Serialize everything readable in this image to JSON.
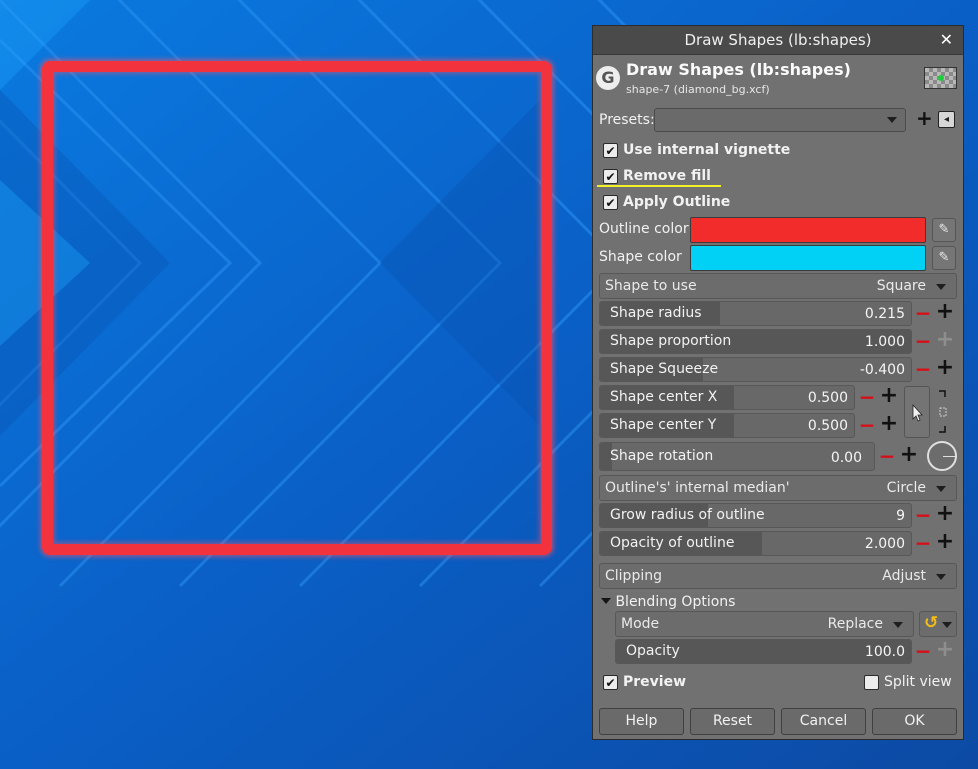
{
  "dialog": {
    "window_title": "Draw Shapes (lb:shapes)",
    "plugin_name": "Draw Shapes (lb:shapes)",
    "file_name": "shape-7 (diamond_bg.xcf)",
    "presets_label": "Presets:",
    "checks": {
      "vignette": "Use internal vignette",
      "remove_fill": "Remove fill",
      "apply_outline": "Apply Outline"
    },
    "outline_color_label": "Outline color",
    "outline_color": "#f22b2b",
    "shape_color_label": "Shape color",
    "shape_color": "#00d1f5",
    "shape_to_use": {
      "label": "Shape to use",
      "value": "Square"
    },
    "params": {
      "radius": {
        "label": "Shape radius",
        "value": "0.215"
      },
      "proportion": {
        "label": "Shape proportion",
        "value": "1.000"
      },
      "squeeze": {
        "label": "Shape Squeeze",
        "value": "-0.400"
      },
      "center_x": {
        "label": "Shape center X",
        "value": "0.500"
      },
      "center_y": {
        "label": "Shape center Y",
        "value": "0.500"
      },
      "rotation": {
        "label": "Shape rotation",
        "value": "0.00"
      }
    },
    "median": {
      "label": "Outline's' internal median'",
      "value": "Circle"
    },
    "grow_radius": {
      "label": "Grow radius of outline",
      "value": "9"
    },
    "opacity_outline": {
      "label": "Opacity of outline",
      "value": "2.000"
    },
    "clipping": {
      "label": "Clipping",
      "value": "Adjust"
    },
    "blending": {
      "header": "Blending Options",
      "mode_label": "Mode",
      "mode_value": "Replace",
      "opacity_label": "Opacity",
      "opacity_value": "100.0"
    },
    "preview_label": "Preview",
    "split_view_label": "Split view",
    "buttons": {
      "help": "Help",
      "reset": "Reset",
      "cancel": "Cancel",
      "ok": "OK"
    },
    "glyphs": {
      "close": "✕",
      "check": "✔",
      "plus": "+",
      "minus": "−",
      "pick": "✎",
      "undo": "↺",
      "collapse": "◂",
      "triangle": "▾",
      "logo": "G"
    }
  }
}
